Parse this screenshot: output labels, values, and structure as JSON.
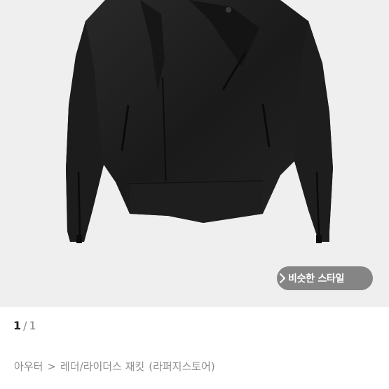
{
  "product_image": {
    "alt_subject": "black-leather-rider-jacket"
  },
  "similar_style": {
    "label": "비슷한 스타일",
    "icon": "chevron-right-icon"
  },
  "pager": {
    "current": "1",
    "separator": "/",
    "total": "1"
  },
  "breadcrumb": {
    "category": "아우터",
    "separator": ">",
    "subcategory": "레더/라이더스 재킷",
    "store": "(라퍼지스토어)"
  },
  "colors": {
    "image_bg": "#efefef",
    "button_bg": "#6e6e6e",
    "text_muted": "#8e8e8e"
  }
}
